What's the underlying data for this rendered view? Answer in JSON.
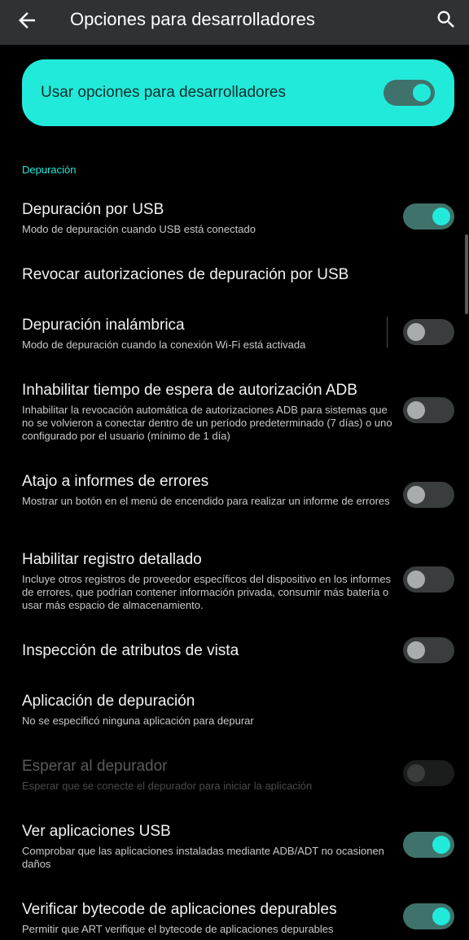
{
  "appbar": {
    "title": "Opciones para desarrolladores",
    "back_icon": "arrow-back-icon",
    "search_icon": "search-icon"
  },
  "master_toggle": {
    "label": "Usar opciones para desarrolladores",
    "on": true
  },
  "section": {
    "title": "Depuración"
  },
  "items": [
    {
      "title": "Depuración por USB",
      "subtitle": "Modo de depuración cuando USB está conectado",
      "switch": "on"
    },
    {
      "title": "Revocar autorizaciones de depuración por USB",
      "subtitle": "",
      "switch": "none"
    },
    {
      "title": "Depuración inalámbrica",
      "subtitle": "Modo de depuración cuando la conexión Wi-Fi está activada",
      "switch": "off"
    },
    {
      "title": "Inhabilitar tiempo de espera de autorización ADB",
      "subtitle": "Inhabilitar la revocación automática de autorizaciones ADB para sistemas que no se volvieron a conectar dentro de un período predeterminado (7 días) o uno configurado por el usuario (mínimo de 1 día)",
      "switch": "off"
    },
    {
      "title": "Atajo a informes de errores",
      "subtitle": "Mostrar un botón en el menú de encendido para realizar un informe de errores",
      "switch": "off"
    },
    {
      "title": "Habilitar registro detallado",
      "subtitle": "Incluye otros registros de proveedor específicos del dispositivo en los informes de errores, que podrían contener información privada, consumir más batería o usar más espacio de almacenamiento.",
      "switch": "off"
    },
    {
      "title": "Inspección de atributos de vista",
      "subtitle": "",
      "switch": "off"
    },
    {
      "title": "Aplicación de depuración",
      "subtitle": "No se especificó ninguna aplicación para depurar",
      "switch": "none"
    },
    {
      "title": "Esperar al depurador",
      "subtitle": "Esperar que se conecte el depurador para iniciar la aplicación",
      "switch": "disabled"
    },
    {
      "title": "Ver aplicaciones USB",
      "subtitle": "Comprobar que las aplicaciones instaladas mediante ADB/ADT no ocasionen daños",
      "switch": "on"
    },
    {
      "title": "Verificar bytecode de aplicaciones depurables",
      "subtitle": "Permitir que ART verifique el bytecode de aplicaciones depurables",
      "switch": "on"
    }
  ],
  "colors": {
    "accent": "#22eadb",
    "appbar": "#303133",
    "background": "#000000"
  }
}
